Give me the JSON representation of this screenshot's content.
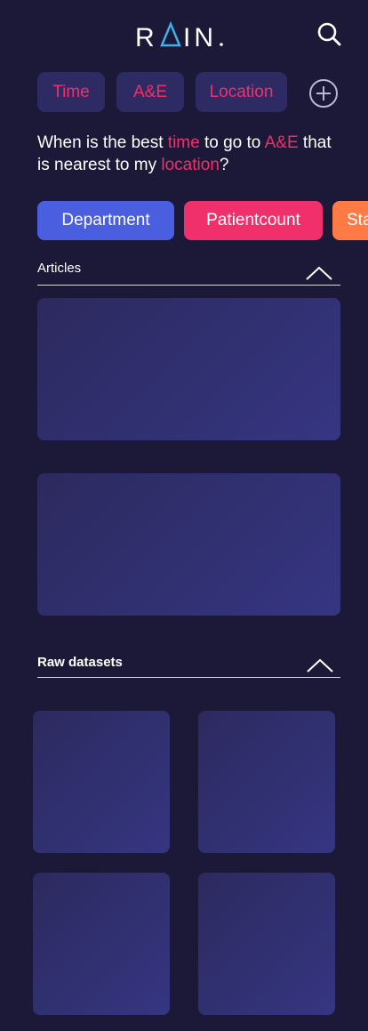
{
  "header": {
    "logo_text": "RAIN.",
    "icons": {
      "search": "search-icon",
      "add": "plus-circle-icon",
      "collapse": "chevron-up-icon"
    }
  },
  "query_chips": [
    {
      "label": "Time"
    },
    {
      "label": "A&E"
    },
    {
      "label": "Location"
    }
  ],
  "question": {
    "part1": "When is the best ",
    "hl1": "time",
    "part2": " to go to ",
    "hl2": "A&E",
    "part3": " that is nearest to my ",
    "hl3": "location",
    "part4": "?"
  },
  "filters": [
    {
      "label": "Department",
      "color": "#4a5fe0"
    },
    {
      "label": "Patientcount",
      "color": "#f0306a"
    },
    {
      "label": "Sta",
      "color": "#ff7a45"
    }
  ],
  "articles": {
    "title": "Articles"
  },
  "raw_datasets": {
    "title": "Raw datasets"
  },
  "colors": {
    "background": "#1b1838",
    "chip_bg": "#2e2a63",
    "accent_pink": "#f0306a",
    "accent_blue": "#4a5fe0",
    "accent_orange": "#ff7a45",
    "logo_accent": "#3fb0e8"
  }
}
